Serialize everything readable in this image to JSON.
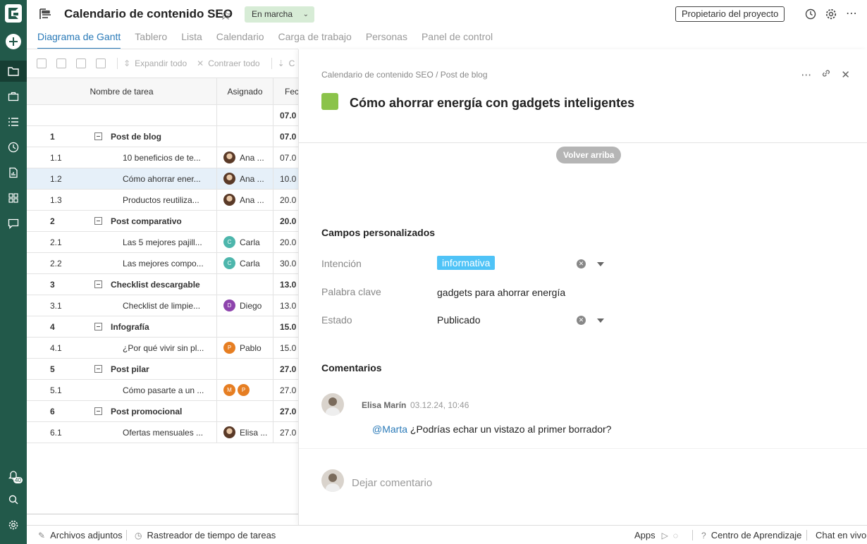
{
  "sidebar": {
    "notifications_count": "40"
  },
  "header": {
    "title": "Calendario de contenido SEO",
    "status": "En marcha",
    "owner_button": "Propietario del proyecto"
  },
  "tabs": [
    {
      "label": "Diagrama de Gantt",
      "active": true
    },
    {
      "label": "Tablero"
    },
    {
      "label": "Lista"
    },
    {
      "label": "Calendario"
    },
    {
      "label": "Carga de trabajo"
    },
    {
      "label": "Personas"
    },
    {
      "label": "Panel de control"
    }
  ],
  "toolbar": {
    "expand_all": "Expandir todo",
    "collapse_all": "Contraer todo",
    "next_partial": "C"
  },
  "table": {
    "headers": {
      "name": "Nombre de tarea",
      "assignee": "Asignado",
      "date": "Fec"
    },
    "first_date": "07.0",
    "rows": [
      {
        "num": "1",
        "name": "Post de blog",
        "date": "07.0",
        "group": true
      },
      {
        "num": "1.1",
        "name": "10 beneficios de te...",
        "assignee": "Ana ...",
        "date": "07.0"
      },
      {
        "num": "1.2",
        "name": "Cómo ahorrar ener...",
        "assignee": "Ana ...",
        "date": "10.0",
        "selected": true
      },
      {
        "num": "1.3",
        "name": "Productos reutiliza...",
        "assignee": "Ana ...",
        "date": "20.0"
      },
      {
        "num": "2",
        "name": "Post comparativo",
        "date": "20.0",
        "group": true
      },
      {
        "num": "2.1",
        "name": "Las 5 mejores pajill...",
        "assignee": "Carla",
        "initial": "C",
        "date": "20.0"
      },
      {
        "num": "2.2",
        "name": "Las mejores compo...",
        "assignee": "Carla",
        "initial": "C",
        "date": "30.0"
      },
      {
        "num": "3",
        "name": "Checklist descargable",
        "date": "13.0",
        "group": true
      },
      {
        "num": "3.1",
        "name": "Checklist de limpie...",
        "assignee": "Diego",
        "initial": "D",
        "date": "13.0"
      },
      {
        "num": "4",
        "name": "Infografía",
        "date": "15.0",
        "group": true
      },
      {
        "num": "4.1",
        "name": "¿Por qué vivir sin pl...",
        "assignee": "Pablo",
        "initial": "P",
        "date": "15.0"
      },
      {
        "num": "5",
        "name": "Post pilar",
        "date": "27.0",
        "group": true
      },
      {
        "num": "5.1",
        "name": "Cómo pasarte a un ...",
        "initials": [
          "M",
          "P"
        ],
        "date": "27.0"
      },
      {
        "num": "6",
        "name": "Post promocional",
        "date": "27.0",
        "group": true
      },
      {
        "num": "6.1",
        "name": "Ofertas mensuales ...",
        "assignee": "Elisa ...",
        "date": "27.0"
      }
    ]
  },
  "panel": {
    "breadcrumb": "Calendario de contenido SEO / Post de blog",
    "task_title": "Cómo ahorrar energía con gadgets inteligentes",
    "task_color": "#8bc34a",
    "back_to_top": "Volver arriba",
    "custom_fields_title": "Campos personalizados",
    "fields": {
      "intent_label": "Intención",
      "intent_value": "informativa",
      "keyword_label": "Palabra clave",
      "keyword_value": "gadgets para ahorrar energía",
      "status_label": "Estado",
      "status_value": "Publicado"
    },
    "comments_title": "Comentarios",
    "comment": {
      "author": "Elisa Marín",
      "time": "03.12.24, 10:46",
      "mention": "@Marta",
      "text": "¿Podrías echar un vistazo al primer borrador?"
    },
    "comment_placeholder": "Dejar comentario"
  },
  "footer": {
    "attachments": "Archivos adjuntos",
    "time_tracker": "Rastreador de tiempo de tareas",
    "apps": "Apps",
    "learning_center": "Centro de Aprendizaje",
    "live_chat": "Chat en vivo"
  }
}
